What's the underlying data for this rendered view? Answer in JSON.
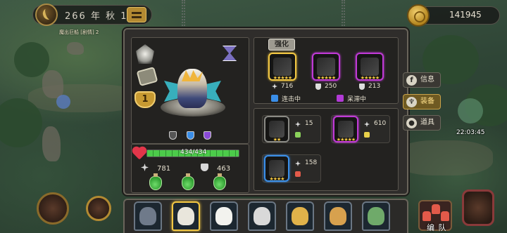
{
  "top_bar": {
    "date": "266 年 秋 14",
    "gold": "141945",
    "icons": {
      "date": "crescent-moon-icon",
      "menu": "menu-icon",
      "gold": "coin-icon"
    }
  },
  "map": {
    "label": "魔出巨船 [剧情] 2"
  },
  "hero": {
    "level": "1",
    "hp_text": "434/434",
    "hp_fraction": 1.0,
    "attack": "781",
    "defense": "463"
  },
  "equipment": {
    "tab_label": "强化",
    "equipped": [
      {
        "icon": "spear-icon",
        "rarity": "gold",
        "stars": "★★★★★",
        "value": "716",
        "stat_icon": "attack-icon"
      },
      {
        "icon": "hammer-icon",
        "rarity": "purple",
        "stars": "★★★★★",
        "value": "250",
        "stat_icon": "defense-icon"
      },
      {
        "icon": "gauntlet-icon",
        "rarity": "purple",
        "stars": "★★★★★",
        "value": "213",
        "stat_icon": "defense-icon"
      }
    ],
    "status": [
      {
        "label": "连击中",
        "color": "#3a8ee8"
      },
      {
        "label": "呆滞中",
        "color": "#b23ad6"
      }
    ],
    "inventory": [
      {
        "icon": "scythe-icon",
        "rarity": "gray",
        "stars": "★★",
        "value": "15",
        "stat_icon": "attack-icon",
        "tag_color": "#8ad15a"
      },
      {
        "icon": "blade-icon",
        "rarity": "purple",
        "stars": "★★★★★",
        "value": "610",
        "stat_icon": "attack-icon",
        "tag_color": "#e8d04a"
      },
      {
        "icon": "crossbow-icon",
        "rarity": "blue",
        "stars": "★★★★",
        "value": "158",
        "stat_icon": "attack-icon",
        "tag_color": "#e25a4a"
      }
    ]
  },
  "side_menu": [
    {
      "label": "信息",
      "icon_char": "f",
      "icon": "info-icon",
      "active": false
    },
    {
      "label": "装备",
      "icon_char": "♆",
      "icon": "equipment-icon",
      "active": true
    },
    {
      "label": "道具",
      "icon_char": "●",
      "icon": "item-bag-icon",
      "active": false
    }
  ],
  "timer": "22:03:45",
  "roster": [
    {
      "name": "wolf-knight",
      "color": "#6f7a8a",
      "selected": false
    },
    {
      "name": "eagle-warrior",
      "color": "#e9e6dc",
      "selected": true
    },
    {
      "name": "polar-bear",
      "color": "#f2f2ee",
      "selected": false
    },
    {
      "name": "white-hair-hero",
      "color": "#d9d9d9",
      "selected": false
    },
    {
      "name": "cheetah",
      "color": "#e0b24a",
      "selected": false
    },
    {
      "name": "giraffe",
      "color": "#d7a14e",
      "selected": false
    },
    {
      "name": "frog-knight",
      "color": "#6faa6a",
      "selected": false
    }
  ],
  "team_button": {
    "label": "编 队"
  }
}
